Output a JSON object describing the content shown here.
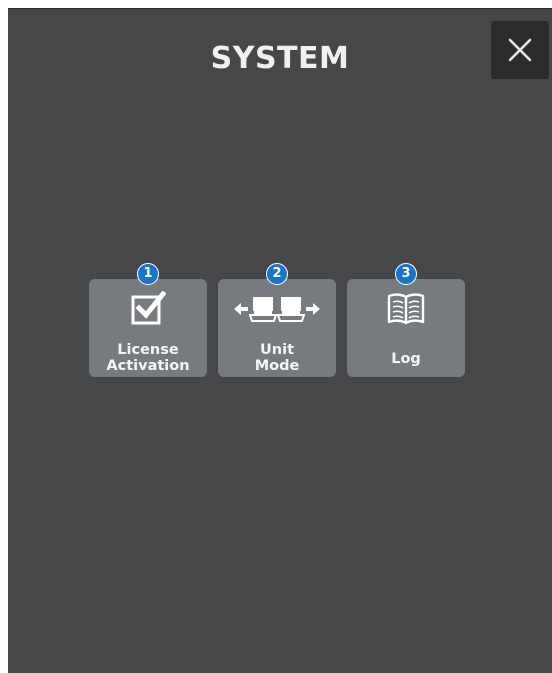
{
  "header": {
    "title": "SYSTEM",
    "close_label": "✕"
  },
  "tiles": [
    {
      "badge": "1",
      "icon": "checkbox-check-icon",
      "label_line1": "License",
      "label_line2": "Activation"
    },
    {
      "badge": "2",
      "icon": "unit-mode-icon",
      "label_line1": "Unit",
      "label_line2": "Mode"
    },
    {
      "badge": "3",
      "icon": "book-icon",
      "label_line1": "Log"
    }
  ],
  "colors": {
    "panel_bg": "#454749",
    "tile_bg": "#777b7f",
    "close_bg": "#2b2c2e",
    "badge_bg": "#1b74c9",
    "text": "#f4f5f6"
  }
}
